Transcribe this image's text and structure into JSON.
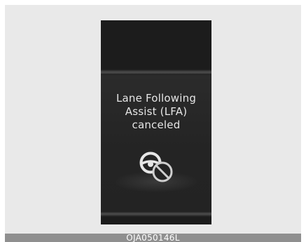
{
  "cluster": {
    "message_lines": [
      "Lane Following",
      "Assist (LFA)",
      "canceled"
    ],
    "icon": "steering-wheel-cancel-icon"
  },
  "caption": {
    "code": "OJA050146L"
  },
  "colors": {
    "background": "#e9e9e9",
    "cluster": "#1c1c1c",
    "text": "#e6e6e6",
    "caption_bar": "#8f8f8f"
  }
}
